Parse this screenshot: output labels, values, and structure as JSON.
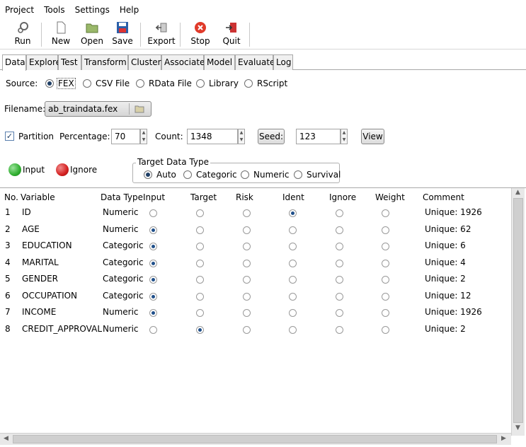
{
  "menu": [
    "Project",
    "Tools",
    "Settings",
    "Help"
  ],
  "toolbar": {
    "run": "Run",
    "new": "New",
    "open": "Open",
    "save": "Save",
    "export": "Export",
    "stop": "Stop",
    "quit": "Quit"
  },
  "tabs": [
    "Data",
    "Explore",
    "Test",
    "Transform",
    "Cluster",
    "Associate",
    "Model",
    "Evaluate",
    "Log"
  ],
  "source": {
    "label": "Source:",
    "options": [
      "FEX",
      "CSV File",
      "RData File",
      "Library",
      "RScript"
    ],
    "selected": "FEX"
  },
  "filename": {
    "label": "Filename:",
    "value": "ab_traindata.fex"
  },
  "partition": {
    "label": "Partition",
    "checked": true,
    "percentage_label": "Percentage:",
    "percentage": "70",
    "count_label": "Count:",
    "count": "1348",
    "seed_button": "Seed:",
    "seed": "123",
    "view_button": "View"
  },
  "legend": {
    "input": "Input",
    "ignore": "Ignore"
  },
  "target_type": {
    "title": "Target Data Type",
    "options": [
      "Auto",
      "Categoric",
      "Numeric",
      "Survival"
    ],
    "selected": "Auto"
  },
  "table": {
    "headers": [
      "No.",
      "Variable",
      "Data Type",
      "Input",
      "Target",
      "Risk",
      "Ident",
      "Ignore",
      "Weight",
      "Comment"
    ],
    "rows": [
      {
        "no": "1",
        "variable": "ID",
        "type": "Numeric",
        "role": "ident",
        "comment": "Unique: 1926"
      },
      {
        "no": "2",
        "variable": "AGE",
        "type": "Numeric",
        "role": "input",
        "comment": "Unique: 62"
      },
      {
        "no": "3",
        "variable": "EDUCATION",
        "type": "Categoric",
        "role": "input",
        "comment": "Unique: 6"
      },
      {
        "no": "4",
        "variable": "MARITAL",
        "type": "Categoric",
        "role": "input",
        "comment": "Unique: 4"
      },
      {
        "no": "5",
        "variable": "GENDER",
        "type": "Categoric",
        "role": "input",
        "comment": "Unique: 2"
      },
      {
        "no": "6",
        "variable": "OCCUPATION",
        "type": "Categoric",
        "role": "input",
        "comment": "Unique: 12"
      },
      {
        "no": "7",
        "variable": "INCOME",
        "type": "Numeric",
        "role": "input",
        "comment": "Unique: 1926"
      },
      {
        "no": "8",
        "variable": "CREDIT_APPROVAL",
        "type": "Numeric",
        "role": "target",
        "comment": "Unique: 2"
      }
    ]
  },
  "colors": {
    "input_ball": "#2fae2f",
    "ignore_ball": "#d42020",
    "stop": "#e03a2a"
  }
}
